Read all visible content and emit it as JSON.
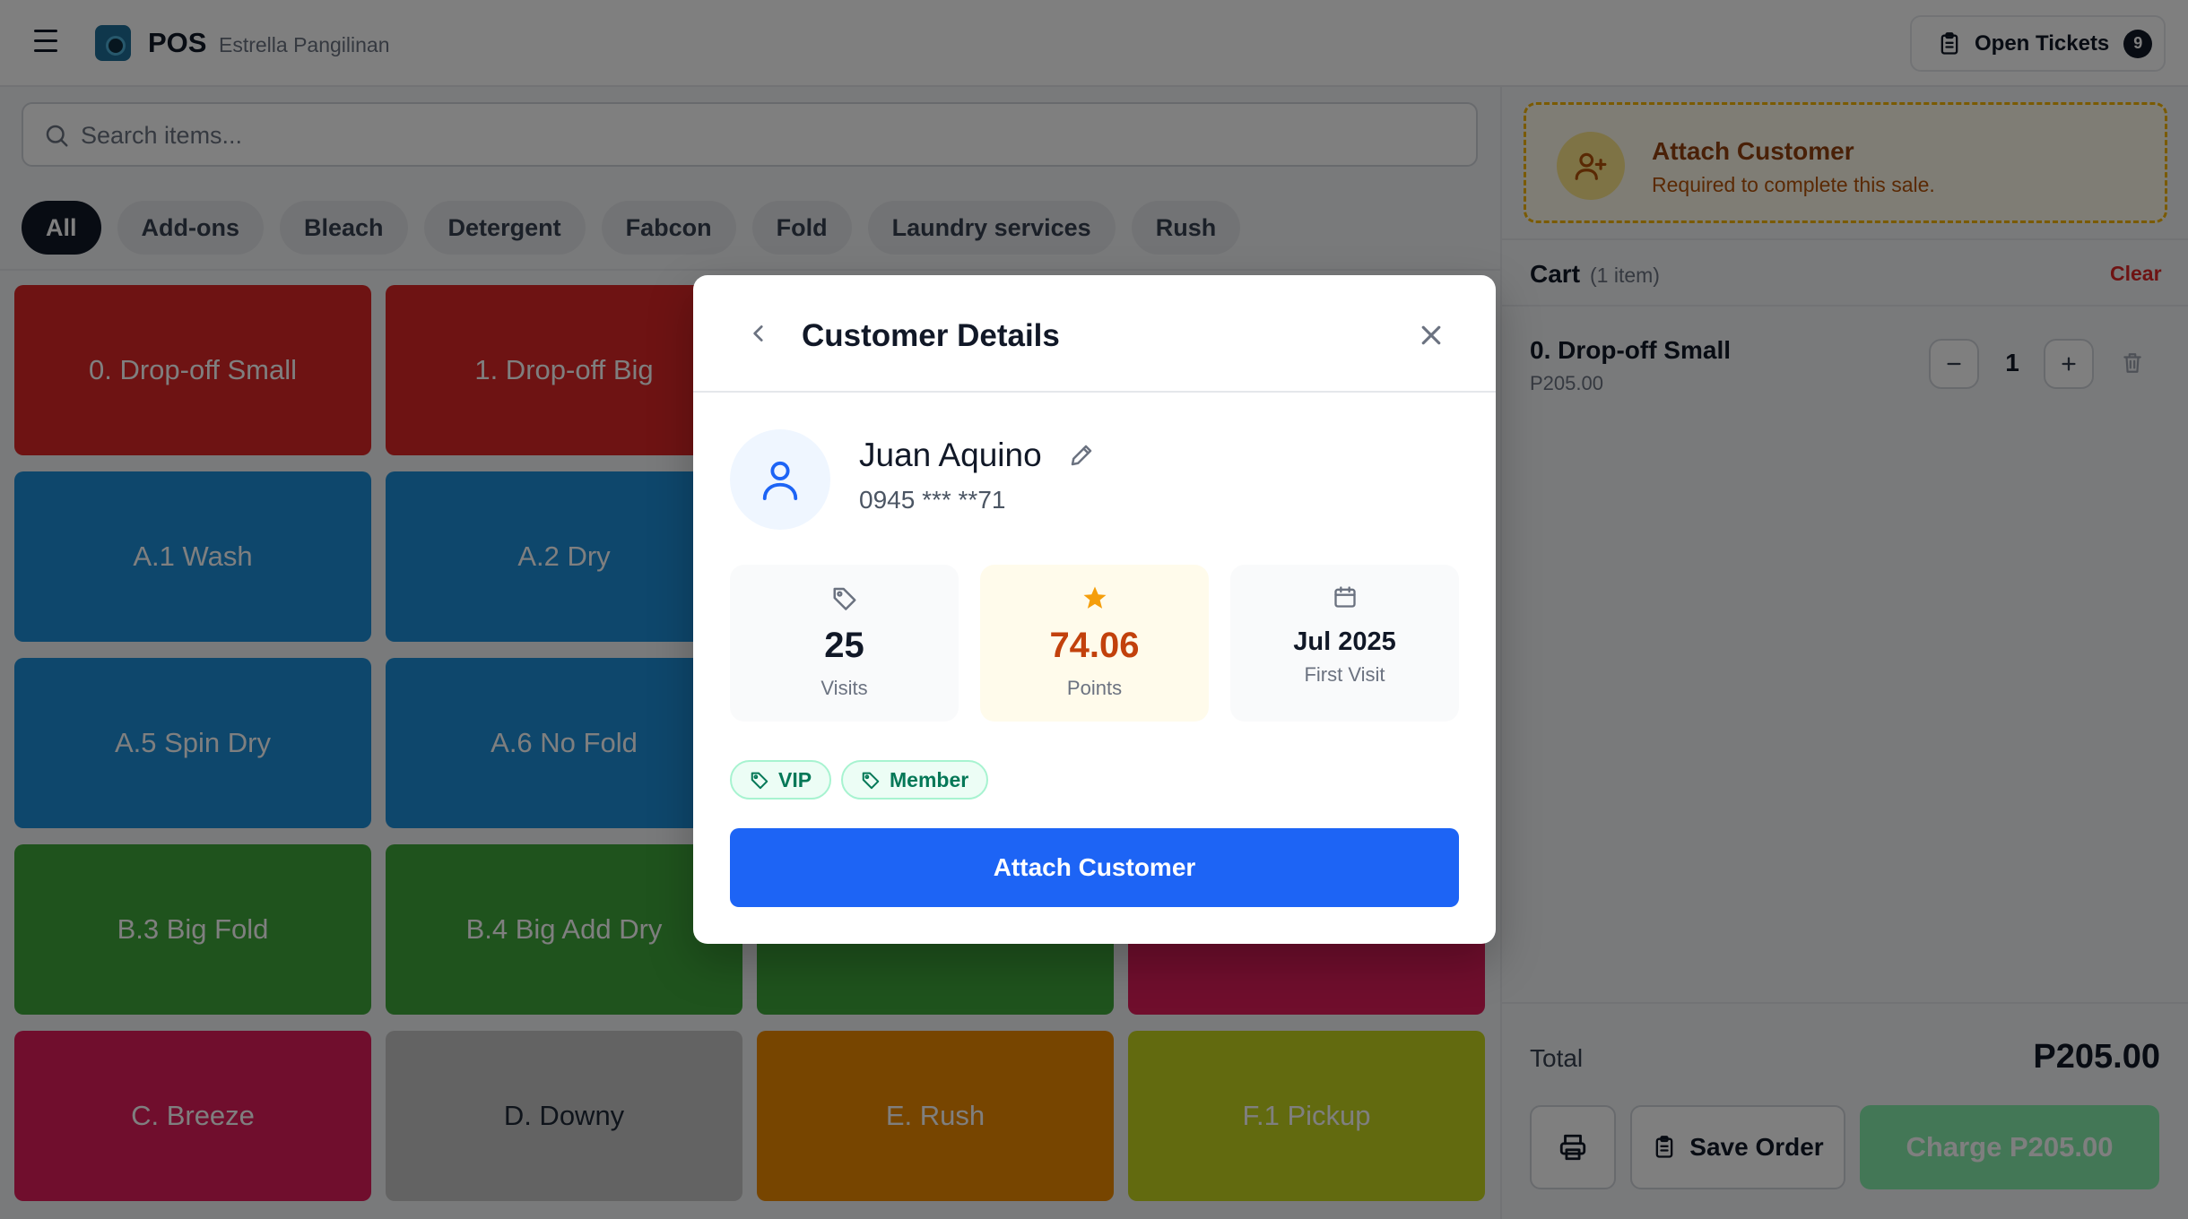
{
  "header": {
    "app_name": "POS",
    "user_name": "Estrella Pangilinan",
    "open_tickets_label": "Open Tickets",
    "open_tickets_count": "9"
  },
  "search": {
    "placeholder": "Search items..."
  },
  "categories": [
    "All",
    "Add-ons",
    "Bleach",
    "Detergent",
    "Fabcon",
    "Fold",
    "Laundry services",
    "Rush"
  ],
  "active_category": "All",
  "items": [
    {
      "label": "0. Drop-off Small",
      "color": "#dc2626"
    },
    {
      "label": "1. Drop-off Big",
      "color": "#dc2626"
    },
    {
      "label": "",
      "color": "#dc2626"
    },
    {
      "label": "",
      "color": "#dc2626"
    },
    {
      "label": "A.1 Wash",
      "color": "#1d8ed8"
    },
    {
      "label": "A.2 Dry",
      "color": "#1d8ed8"
    },
    {
      "label": "",
      "color": "#1d8ed8"
    },
    {
      "label": "",
      "color": "#1d8ed8"
    },
    {
      "label": "A.5 Spin Dry",
      "color": "#1d8ed8"
    },
    {
      "label": "A.6 No Fold",
      "color": "#1d8ed8"
    },
    {
      "label": "",
      "color": "#1d8ed8"
    },
    {
      "label": "",
      "color": "#1d8ed8"
    },
    {
      "label": "B.3 Big Fold",
      "color": "#3fa63a"
    },
    {
      "label": "B.4 Big Add Dry",
      "color": "#3fa63a"
    },
    {
      "label": "",
      "color": "#3fa63a"
    },
    {
      "label": "",
      "color": "#e11d5b"
    },
    {
      "label": "C. Breeze",
      "color": "#e11d5b"
    },
    {
      "label": "D. Downy",
      "color": "#c7c7c7"
    },
    {
      "label": "E. Rush",
      "color": "#ee8a00"
    },
    {
      "label": "F.1 Pickup",
      "color": "#c4d41e"
    }
  ],
  "attach_banner": {
    "title": "Attach Customer",
    "subtitle": "Required to complete this sale."
  },
  "cart": {
    "title": "Cart",
    "count_label": "(1 item)",
    "clear_label": "Clear",
    "line": {
      "name": "0. Drop-off Small",
      "price": "P205.00",
      "qty": "1"
    },
    "total_label": "Total",
    "total_value": "P205.00",
    "save_label": "Save Order",
    "charge_label": "Charge P205.00"
  },
  "modal": {
    "title": "Customer Details",
    "customer_name": "Juan Aquino",
    "phone": "0945 *** **71",
    "stats": {
      "visits_value": "25",
      "visits_label": "Visits",
      "points_value": "74.06",
      "points_label": "Points",
      "first_visit_value": "Jul 2025",
      "first_visit_label": "First Visit"
    },
    "tags": [
      "VIP",
      "Member"
    ],
    "attach_button": "Attach Customer"
  },
  "colors": {
    "primary": "#1d64f5",
    "charge": "#86efac",
    "points": "#c2410c",
    "star": "#f59e0b",
    "danger": "#dc2626"
  },
  "icons": [
    "menu-icon",
    "logo-icon",
    "clipboard-icon",
    "search-icon",
    "user-plus-icon",
    "minus-icon",
    "plus-icon",
    "trash-icon",
    "printer-icon",
    "chevron-left-icon",
    "close-icon",
    "user-icon",
    "pencil-icon",
    "tag-icon",
    "star-icon",
    "calendar-icon"
  ]
}
